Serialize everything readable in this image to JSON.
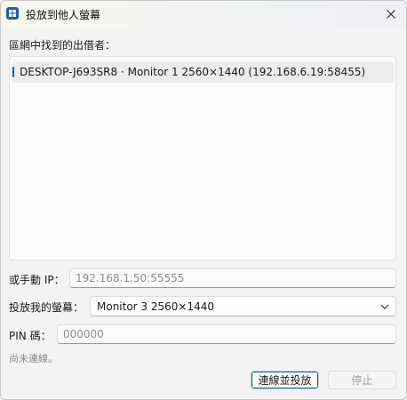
{
  "window": {
    "title": "投放到他人螢幕",
    "icon": "cast-grid-icon"
  },
  "receivers": {
    "label": "區網中找到的出借者：",
    "items": [
      {
        "text": "DESKTOP-J693SR8 · Monitor 1  2560×1440  (192.168.6.19:58455)",
        "selected": true
      }
    ]
  },
  "manual_ip": {
    "label": "或手動 IP：",
    "placeholder": "192.168.1.50:55555",
    "value": ""
  },
  "my_screen": {
    "label": "投放我的螢幕：",
    "selected": "Monitor 3  2560×1440"
  },
  "pin": {
    "label": "PIN 碼：",
    "placeholder": "000000",
    "value": ""
  },
  "status_text": "尚未連線。",
  "buttons": {
    "connect": "連線並投放",
    "stop": "停止"
  },
  "colors": {
    "accent": "#005fb8",
    "background": "#f3f3f3"
  }
}
